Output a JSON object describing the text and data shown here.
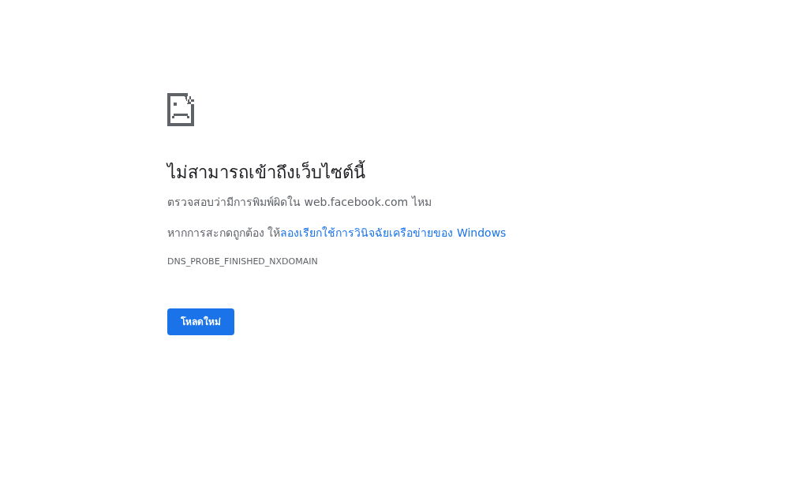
{
  "heading": "ไม่สามารถเข้าถึงเว็บไซต์นี้",
  "suggestion": "ตรวจสอบว่ามีการพิมพ์ผิดใน web.facebook.com ไหม",
  "diagnostics": {
    "text": "หากการสะกดถูกต้อง ให้",
    "link": "ลองเรียกใช้การวินิจฉัยเครือข่ายของ Windows"
  },
  "error_code": "DNS_PROBE_FINISHED_NXDOMAIN",
  "reload_button": "โหลดใหม่"
}
